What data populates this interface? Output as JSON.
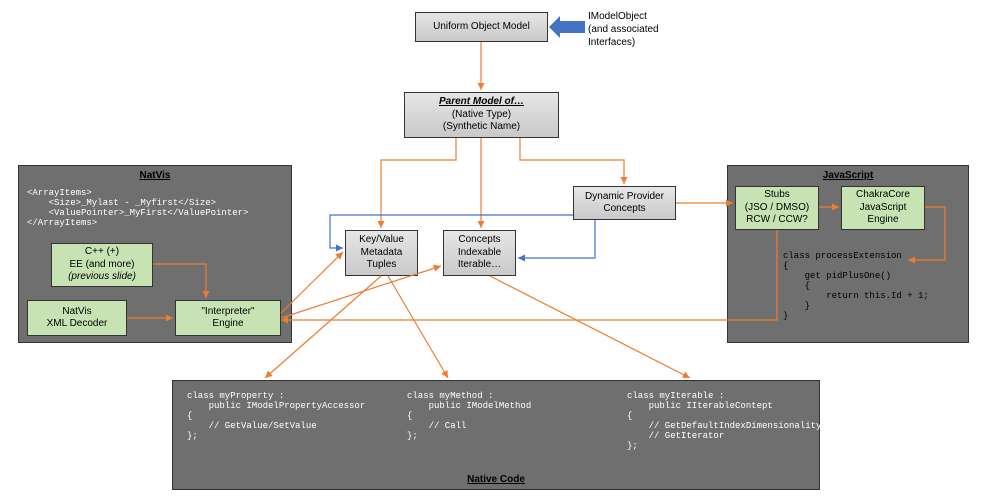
{
  "top": {
    "uniform": "Uniform Object Model",
    "annot_l1": "IModelObject",
    "annot_l2": "(and associated",
    "annot_l3": "Interfaces)"
  },
  "parent": {
    "title": "Parent Model of…",
    "l1": "(Native Type)",
    "l2": "(Synthetic Name)"
  },
  "center": {
    "kv_l1": "Key/Value",
    "kv_l2": "Metadata",
    "kv_l3": "Tuples",
    "cx_l1": "Concepts",
    "cx_l2": "Indexable",
    "cx_l3": "Iterable…",
    "dp_l1": "Dynamic Provider",
    "dp_l2": "Concepts"
  },
  "natvis": {
    "title": "NatVis",
    "xml": "<ArrayItems>\n    <Size>_Mylast - _Myfirst</Size>\n    <ValuePointer>_MyFirst</ValuePointer>\n</ArrayItems>",
    "cpp_l1": "C++ (+)",
    "cpp_l2": "EE (and more)",
    "cpp_l3": "(previous slide)",
    "xmldec_l1": "NatVis",
    "xmldec_l2": "XML Decoder",
    "interp_l1": "\"Interpreter\"",
    "interp_l2": "Engine"
  },
  "js": {
    "title": "JavaScript",
    "stubs_l1": "Stubs",
    "stubs_l2": "(JSO / DMSO)",
    "stubs_l3": "RCW / CCW?",
    "chakra_l1": "ChakraCore",
    "chakra_l2": "JavaScript",
    "chakra_l3": "Engine",
    "code": "class processExtension\n{\n    get pidPlusOne()\n    {\n        return this.Id + 1;\n    }\n}"
  },
  "native": {
    "title": "Native Code",
    "prop": "class myProperty :\n    public IModelPropertyAccessor\n{\n    // GetValue/SetValue\n};",
    "method": "class myMethod :\n    public IModelMethod\n{\n    // Call\n};",
    "iter": "class myIterable :\n    public IIterableContept\n{\n    // GetDefaultIndexDimensionality\n    // GetIterator\n};"
  }
}
